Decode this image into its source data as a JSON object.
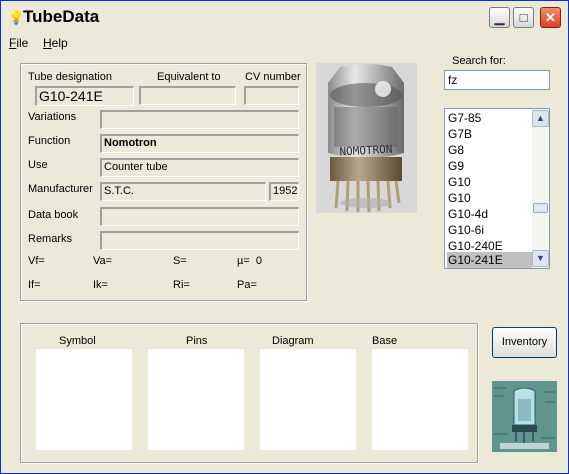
{
  "window": {
    "title": "TubeData"
  },
  "menu": [
    {
      "pre": "",
      "u": "F",
      "post": "ile"
    },
    {
      "pre": "",
      "u": "H",
      "post": "elp"
    }
  ],
  "details": {
    "designation_label": "Tube designation",
    "designation_value": "G10-241E",
    "equivalent_label": "Equivalent to",
    "equivalent_value": "",
    "cv_label": "CV number",
    "cv_value": "",
    "variations_label": "Variations",
    "variations_value": "",
    "function_label": "Function",
    "function_value": "Nomotron",
    "use_label": "Use",
    "use_value": "Counter tube",
    "manufacturer_label": "Manufacturer",
    "manufacturer_value": "S.T.C.",
    "year_value": "1952",
    "databook_label": "Data book",
    "databook_value": "",
    "remarks_label": "Remarks",
    "remarks_value": ""
  },
  "params": [
    {
      "label": "Vf=",
      "value": ""
    },
    {
      "label": "Va=",
      "value": ""
    },
    {
      "label": "S=",
      "value": ""
    },
    {
      "label": "µ=",
      "value": "0"
    },
    {
      "label": "If=",
      "value": ""
    },
    {
      "label": "Ik=",
      "value": ""
    },
    {
      "label": "Ri=",
      "value": ""
    },
    {
      "label": "Pa=",
      "value": ""
    }
  ],
  "photo": {
    "tube_text": "NOMOTRON"
  },
  "search": {
    "label": "Search for:",
    "value": "fz"
  },
  "list": {
    "items": [
      "G7-85",
      "G7B",
      "G8",
      "G9",
      "G10",
      "G10",
      "G10-4d",
      "G10-6i",
      "G10-240E",
      "G10-241E"
    ],
    "selected": "G10-241E"
  },
  "panels": [
    "Symbol",
    "Pins",
    "Diagram",
    "Base"
  ],
  "inventory_label": "Inventory",
  "colors": {
    "title_bar_active": "#0831d9",
    "close_button": "#d84020",
    "selection": "#c0c0c0"
  },
  "icons": {
    "app": "lightbulb-icon",
    "minimize": "minimize-icon",
    "maximize": "maximize-icon",
    "close": "close-icon"
  }
}
